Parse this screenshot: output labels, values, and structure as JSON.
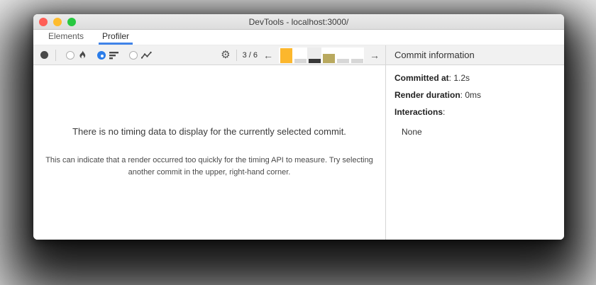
{
  "window": {
    "title": "DevTools - localhost:3000/",
    "traffic_lights": {
      "close": "#ff5f57",
      "minimize": "#febc2e",
      "zoom": "#28c840"
    }
  },
  "tabs": [
    {
      "label": "Elements",
      "selected": false
    },
    {
      "label": "Profiler",
      "selected": true
    }
  ],
  "toolbar": {
    "commit_counter": "3 / 6",
    "prev_arrow": "←",
    "next_arrow": "→",
    "gear_glyph": "⚙",
    "commits": [
      {
        "color": "#fcb72d",
        "height_pct": 91,
        "selected": false
      },
      {
        "color": "#d7d7d7",
        "height_pct": 23,
        "selected": false
      },
      {
        "color": "#383838",
        "height_pct": 27,
        "selected": true
      },
      {
        "color": "#b9a95f",
        "height_pct": 55,
        "selected": false
      },
      {
        "color": "#d7d7d7",
        "height_pct": 23,
        "selected": false
      },
      {
        "color": "#d7d7d7",
        "height_pct": 23,
        "selected": false
      }
    ]
  },
  "panel": {
    "header": "Commit information",
    "fields": [
      {
        "label": "Committed at",
        "value": ": 1.2s"
      },
      {
        "label": "Render duration",
        "value": ": 0ms"
      },
      {
        "label": "Interactions",
        "value": ":"
      }
    ],
    "interactions_value": "None"
  },
  "main": {
    "title": "There is no timing data to display for the currently selected commit.",
    "subtitle": "This can indicate that a render occurred too quickly for the timing API to measure. Try selecting another commit in the upper, right-hand corner."
  },
  "colors": {
    "accent_blue": "#2b7de9",
    "tab_underline": "#4083e8",
    "commit_orange": "#fcb72d",
    "commit_khaki": "#b9a95f"
  }
}
